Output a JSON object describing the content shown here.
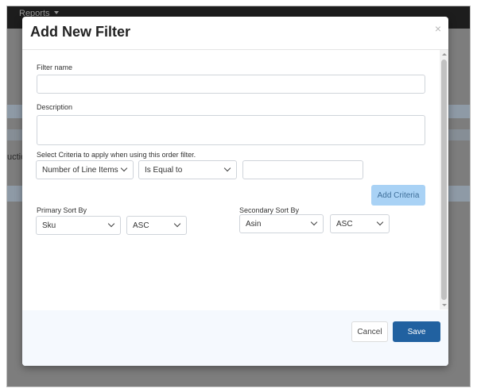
{
  "background": {
    "nav_label": "Reports",
    "partial_text": "uctio"
  },
  "modal": {
    "title": "Add New Filter",
    "close_symbol": "×",
    "filter_name": {
      "label": "Filter name",
      "value": "",
      "placeholder": ""
    },
    "description": {
      "label": "Description",
      "value": "",
      "placeholder": ""
    },
    "criteria": {
      "label": "Select Criteria to apply when using this order filter.",
      "field_selected": "Number of Line Items",
      "operator_selected": "Is Equal to",
      "value": "",
      "add_button": "Add Criteria"
    },
    "primary_sort": {
      "label": "Primary Sort By",
      "field_selected": "Sku",
      "order_selected": "ASC"
    },
    "secondary_sort": {
      "label": "Secondary Sort By",
      "field_selected": "Asin",
      "order_selected": "ASC"
    },
    "footer": {
      "cancel_label": "Cancel",
      "save_label": "Save"
    }
  },
  "colors": {
    "primary_button": "#2161a0",
    "add_criteria_button": "#a9d2f5",
    "footer_background": "#f5f9fe",
    "overlay": "#7d7d7d"
  },
  "icons": [
    "close-icon",
    "chevron-down-icon",
    "scroll-up-arrow",
    "scroll-down-arrow"
  ]
}
